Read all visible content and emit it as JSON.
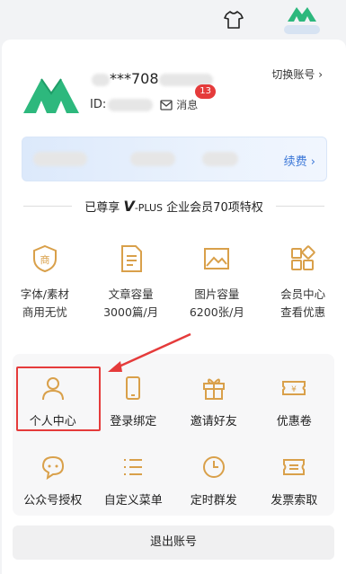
{
  "topbar": {
    "tshirt_icon": "tshirt-icon",
    "avatar_icon": "brand-logo-avatar"
  },
  "user": {
    "name_suffix": "***708",
    "id_label": "ID:",
    "message_label": "消息",
    "message_count": "13",
    "switch_account": "切换账号 ›"
  },
  "vip": {
    "renew_label": "续费 ›"
  },
  "enjoy": {
    "prefix": "已尊享",
    "plus_label": "-PLUS",
    "suffix": "企业会员70项特权"
  },
  "benefits": [
    {
      "icon": "shield-shang-icon",
      "line1": "字体/素材",
      "line2": "商用无忧"
    },
    {
      "icon": "document-icon",
      "line1": "文章容量",
      "line2": "3000篇/月"
    },
    {
      "icon": "image-icon",
      "line1": "图片容量",
      "line2": "6200张/月"
    },
    {
      "icon": "grid-icon",
      "line1": "会员中心",
      "line2": "查看优惠"
    }
  ],
  "features": [
    {
      "icon": "person-icon",
      "label": "个人中心"
    },
    {
      "icon": "phone-icon",
      "label": "登录绑定"
    },
    {
      "icon": "gift-icon",
      "label": "邀请好友"
    },
    {
      "icon": "coupon-icon",
      "label": "优惠卷"
    },
    {
      "icon": "chat-icon",
      "label": "公众号授权"
    },
    {
      "icon": "list-icon",
      "label": "自定义菜单"
    },
    {
      "icon": "clock-icon",
      "label": "定时群发"
    },
    {
      "icon": "invoice-icon",
      "label": "发票索取"
    }
  ],
  "logout_label": "退出账号",
  "colors": {
    "accent_gold": "#d9a04a",
    "brand_green": "#2db87d",
    "link_blue": "#3c78d8",
    "alert_red": "#e53b3b"
  }
}
